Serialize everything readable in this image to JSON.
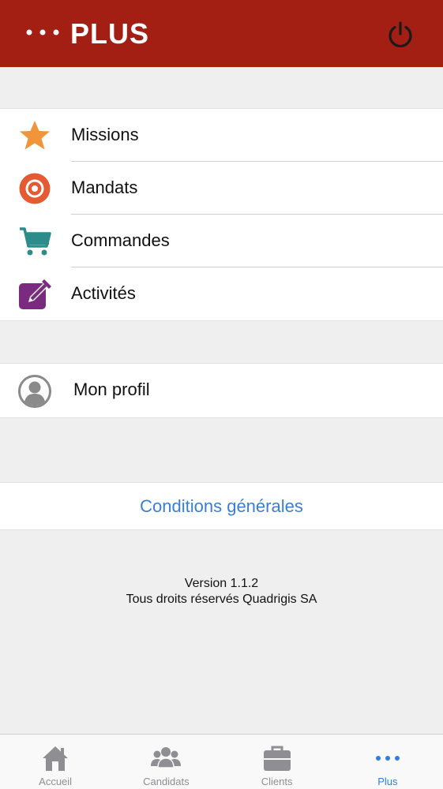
{
  "header": {
    "title": "PLUS"
  },
  "menu": {
    "items": [
      {
        "label": "Missions",
        "icon": "star-icon",
        "color": "#f0953a"
      },
      {
        "label": "Mandats",
        "icon": "target-icon",
        "color": "#e55a30"
      },
      {
        "label": "Commandes",
        "icon": "cart-icon",
        "color": "#2c8c8a"
      },
      {
        "label": "Activités",
        "icon": "edit-icon",
        "color": "#7a2a7f"
      }
    ]
  },
  "profile": {
    "label": "Mon profil",
    "icon": "user-icon"
  },
  "links": {
    "terms": "Conditions générales"
  },
  "footer": {
    "version": "Version 1.1.2",
    "rights": "Tous droits réservés Quadrigis SA"
  },
  "tabbar": {
    "tabs": [
      {
        "label": "Accueil",
        "icon": "home-icon",
        "active": false
      },
      {
        "label": "Candidats",
        "icon": "people-icon",
        "active": false
      },
      {
        "label": "Clients",
        "icon": "briefcase-icon",
        "active": false
      },
      {
        "label": "Plus",
        "icon": "more-icon",
        "active": true
      }
    ]
  },
  "colors": {
    "header_bg": "#a31f14",
    "link": "#3a7fd0",
    "tab_active": "#2f7fe0",
    "tab_inactive": "#8e8e93"
  }
}
